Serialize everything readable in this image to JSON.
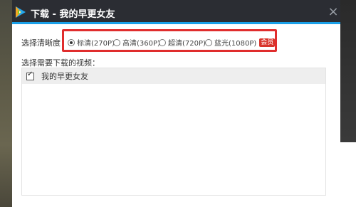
{
  "window": {
    "title": "下载 - 我的早更女友",
    "close_glyph": "×"
  },
  "quality": {
    "label": "选择清晰度",
    "options": [
      {
        "label": "标清(270P)",
        "selected": true
      },
      {
        "label": "高清(360P)",
        "selected": false
      },
      {
        "label": "超清(720P)",
        "selected": false
      },
      {
        "label": "蓝光(1080P)",
        "selected": false
      }
    ],
    "vip_badge": "会员"
  },
  "videos": {
    "label": "选择需要下载的视频：",
    "items": [
      {
        "title": "我的早更女友",
        "checked": true
      }
    ]
  },
  "colors": {
    "titlebar": "#2b2d33",
    "accent_line": "#1aa0e8",
    "highlight": "#e02d2d",
    "badge": "#d9342b"
  }
}
